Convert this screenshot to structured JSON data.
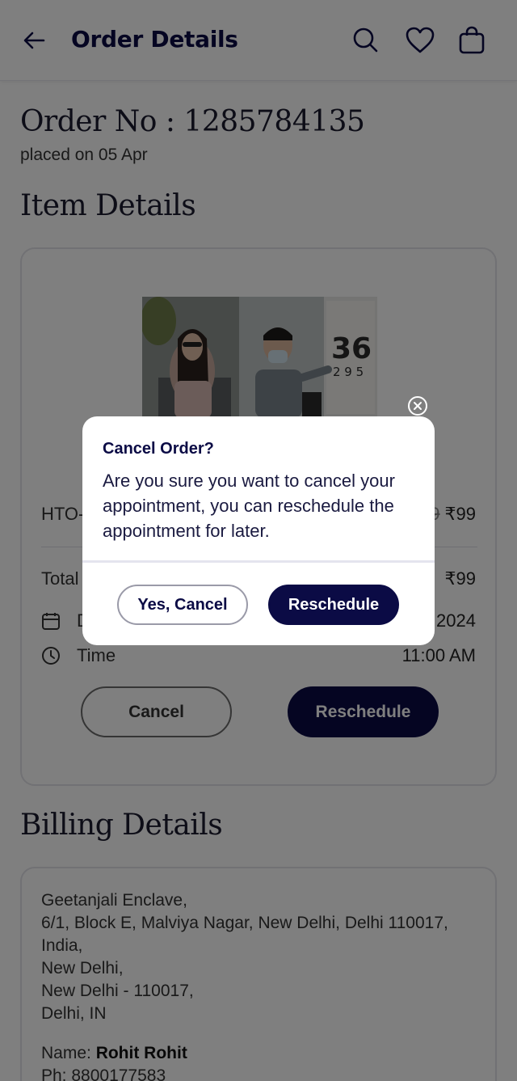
{
  "header": {
    "title": "Order Details"
  },
  "order": {
    "number_label": "Order No : 1285784135",
    "placed_on": "placed on 05 Apr"
  },
  "item_section": {
    "heading": "Item Details",
    "product_name": "HTO-",
    "original_price": "₹99",
    "price": "₹99",
    "total_label": "Total",
    "total_value": "₹99",
    "date_label": "D",
    "date_value": "2024",
    "time_label": "Time",
    "time_value": "11:00 AM",
    "cancel_label": "Cancel",
    "reschedule_label": "Reschedule"
  },
  "billing": {
    "heading": "Billing Details",
    "address_lines": [
      "Geetanjali Enclave,",
      "6/1, Block E, Malviya Nagar, New Delhi, Delhi 110017,",
      "India,",
      "New Delhi,",
      "New Delhi - 110017,",
      "Delhi, IN"
    ],
    "name_label": "Name: ",
    "name_value": "Rohit Rohit",
    "phone_label": "Ph: ",
    "phone_value": "8800177583"
  },
  "dialog": {
    "title": "Cancel Order?",
    "message": "Are you sure you want to cancel your appointment, you can reschedule the appointment for later.",
    "yes_cancel_label": "Yes, Cancel",
    "reschedule_label": "Reschedule"
  },
  "colors": {
    "brand_navy": "#0b0b45",
    "overlay": "rgba(0,0,0,0.5)"
  },
  "icons": [
    "back-arrow-icon",
    "search-icon",
    "heart-icon",
    "bag-icon",
    "calendar-icon",
    "clock-icon",
    "close-icon"
  ]
}
